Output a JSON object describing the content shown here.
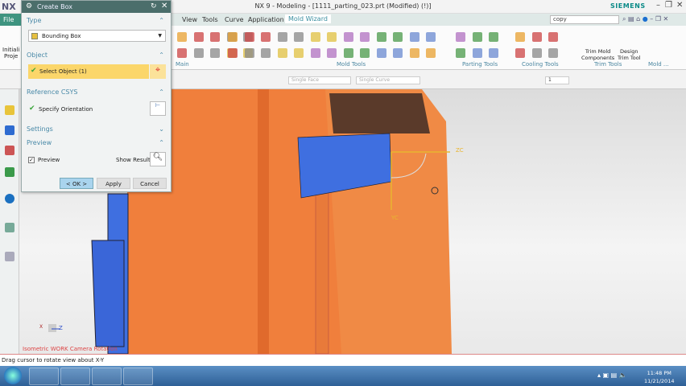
{
  "window": {
    "title": "NX 9 - Modeling - [1111_parting_023.prt (Modified)     (!)]",
    "brand": "SIEMENS",
    "app_logo": "NX"
  },
  "menu": {
    "file": "File",
    "items": [
      "View",
      "Tools",
      "Curve",
      "Application"
    ],
    "active_tab": "Mold Wizard",
    "search_value": "copy"
  },
  "ribbon": {
    "left_button": [
      "Initiali",
      "Proje"
    ],
    "groups": [
      "Main",
      "Mold Tools",
      "Parting Tools",
      "Cooling Tools",
      "Trim Tools",
      "Mold ..."
    ],
    "trim_buttons": [
      [
        "Trim Mold",
        "Components"
      ],
      [
        "Design",
        "Trim Tool"
      ]
    ]
  },
  "toolbar": {
    "face_filter": "Single Face",
    "curve_filter": "Single Curve",
    "layer": "1"
  },
  "dialog": {
    "title": "Create Box",
    "type": {
      "header": "Type",
      "value": "Bounding Box"
    },
    "object": {
      "header": "Object",
      "select_label": "Select Object (1)"
    },
    "csys": {
      "header": "Reference CSYS",
      "orientation_label": "Specify Orientation"
    },
    "settings": {
      "header": "Settings"
    },
    "preview": {
      "header": "Preview",
      "checkbox_label": "Preview",
      "checked": true,
      "show_result": "Show Result"
    },
    "buttons": {
      "ok": "< OK >",
      "apply": "Apply",
      "cancel": "Cancel"
    }
  },
  "viewport": {
    "view_label": "Isometric WORK Camera Rotation",
    "axis_zc": "ZC",
    "axis_yc": "YC",
    "triad_z": "Z",
    "triad_x": "X"
  },
  "status": {
    "message": "Drag cursor to rotate view about X-Y"
  },
  "taskbar": {
    "time": "11:48 PM",
    "date": "11/21/2014"
  },
  "colors": {
    "accent": "#3e9480",
    "part_orange": "#f07f3c",
    "part_blue": "#3f6fe0",
    "select_highlight": "#fbd66a"
  }
}
